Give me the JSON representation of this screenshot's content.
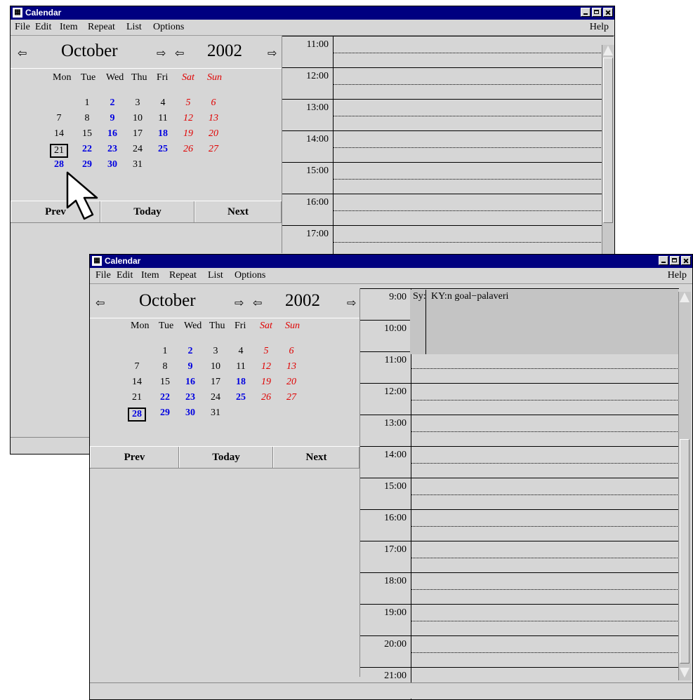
{
  "window_back": {
    "title": "Calendar",
    "menu": [
      "File",
      "Edit",
      "Item",
      "Repeat",
      "List",
      "Options"
    ],
    "help": "Help",
    "month": "October",
    "year": "2002",
    "weekdays": [
      "Mon",
      "Tue",
      "Wed",
      "Thu",
      "Fri",
      "Sat",
      "Sun"
    ],
    "weeks": [
      [
        "",
        "1",
        "2",
        "3",
        "4",
        "5",
        "6"
      ],
      [
        "7",
        "8",
        "9",
        "10",
        "11",
        "12",
        "13"
      ],
      [
        "14",
        "15",
        "16",
        "17",
        "18",
        "19",
        "20"
      ],
      [
        "21",
        "22",
        "23",
        "24",
        "25",
        "26",
        "27"
      ],
      [
        "28",
        "29",
        "30",
        "31",
        "",
        "",
        ""
      ]
    ],
    "busy_days": [
      "2",
      "9",
      "16",
      "18",
      "22",
      "23",
      "25",
      "28",
      "29",
      "30"
    ],
    "selected_day": "21",
    "buttons": {
      "prev": "Prev",
      "today": "Today",
      "next": "Next"
    },
    "hours": [
      "11:00",
      "12:00",
      "13:00",
      "14:00",
      "15:00",
      "16:00",
      "17:00"
    ]
  },
  "window_front": {
    "title": "Calendar",
    "menu": [
      "File",
      "Edit",
      "Item",
      "Repeat",
      "List",
      "Options"
    ],
    "help": "Help",
    "month": "October",
    "year": "2002",
    "weekdays": [
      "Mon",
      "Tue",
      "Wed",
      "Thu",
      "Fri",
      "Sat",
      "Sun"
    ],
    "weeks": [
      [
        "",
        "1",
        "2",
        "3",
        "4",
        "5",
        "6"
      ],
      [
        "7",
        "8",
        "9",
        "10",
        "11",
        "12",
        "13"
      ],
      [
        "14",
        "15",
        "16",
        "17",
        "18",
        "19",
        "20"
      ],
      [
        "21",
        "22",
        "23",
        "24",
        "25",
        "26",
        "27"
      ],
      [
        "28",
        "29",
        "30",
        "31",
        "",
        "",
        ""
      ]
    ],
    "busy_days": [
      "2",
      "9",
      "16",
      "18",
      "22",
      "23",
      "28",
      "29",
      "30",
      "25"
    ],
    "selected_day": "28",
    "buttons": {
      "prev": "Prev",
      "today": "Today",
      "next": "Next"
    },
    "hours": [
      "9:00",
      "10:00",
      "11:00",
      "12:00",
      "13:00",
      "14:00",
      "15:00",
      "16:00",
      "17:00",
      "18:00",
      "19:00",
      "20:00",
      "21:00"
    ],
    "event": {
      "category": "Sy:",
      "text": "KY:n goal−palaveri"
    }
  },
  "icons": [
    "calendar-app-icon",
    "minimize-icon",
    "maximize-icon",
    "close-icon",
    "arrow-left-icon",
    "arrow-right-icon",
    "mouse-pointer-icon"
  ],
  "colors": {
    "title_bar": "#000080",
    "weekend": "#e00000",
    "busy": "#0000e0",
    "background": "#d6d6d6"
  }
}
